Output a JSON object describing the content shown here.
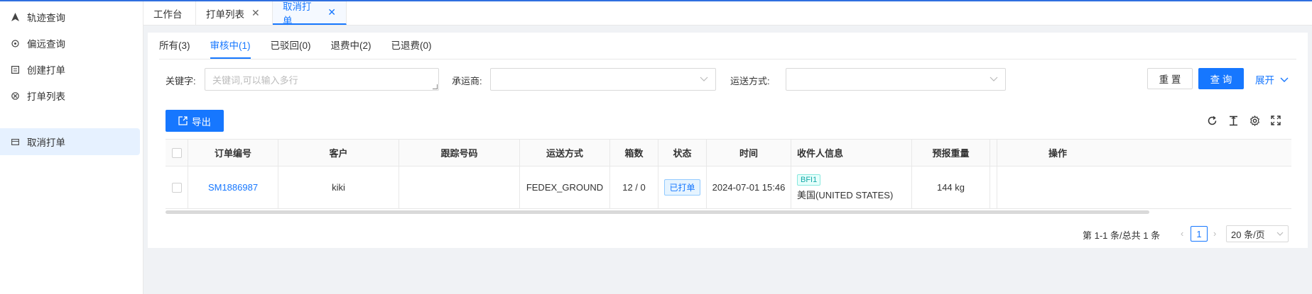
{
  "sidebar": {
    "items": [
      {
        "label": "轨迹查询",
        "icon": "navigation-arrow-icon"
      },
      {
        "label": "偏远查询",
        "icon": "target-icon"
      },
      {
        "label": "创建打单",
        "icon": "document-icon"
      },
      {
        "label": "打单列表",
        "icon": "list-circle-icon"
      },
      {
        "label": "取消打单",
        "icon": "card-icon"
      }
    ],
    "active_index": 4
  },
  "tabs": [
    {
      "label": "工作台",
      "closable": false
    },
    {
      "label": "打单列表",
      "closable": true
    },
    {
      "label": "取消打单",
      "closable": true,
      "active": true
    }
  ],
  "subtabs": [
    {
      "label": "所有(3)"
    },
    {
      "label": "审核中(1)",
      "active": true
    },
    {
      "label": "已驳回(0)"
    },
    {
      "label": "退费中(2)"
    },
    {
      "label": "已退费(0)"
    }
  ],
  "filters": {
    "keyword_label": "关键字:",
    "keyword_placeholder": "关键词,可以输入多行",
    "carrier_label": "承运商:",
    "shipping_label": "运送方式:"
  },
  "actions": {
    "reset": "重 置",
    "query": "查 询",
    "expand": "展开",
    "export": "导出"
  },
  "table": {
    "columns": [
      "订单编号",
      "客户",
      "跟踪号码",
      "运送方式",
      "箱数",
      "状态",
      "时间",
      "收件人信息",
      "预报重量",
      "操作"
    ],
    "rows": [
      {
        "order_no": "SM1886987",
        "customer": "kiki",
        "tracking": "",
        "shipping": "FEDEX_GROUND",
        "boxes": "12 / 0",
        "status": "已打单",
        "time": "2024-07-01 15:46",
        "recipient_code": "BFI1",
        "recipient_country": "美国(UNITED STATES)",
        "weight": "144 kg"
      }
    ]
  },
  "pagination": {
    "summary": "第 1-1 条/总共 1 条",
    "current_page": "1",
    "page_size": "20 条/页"
  },
  "colors": {
    "accent": "#1677ff",
    "status_tag_bg": "#e6f4ff",
    "code_tag_color": "#13a8a8"
  }
}
